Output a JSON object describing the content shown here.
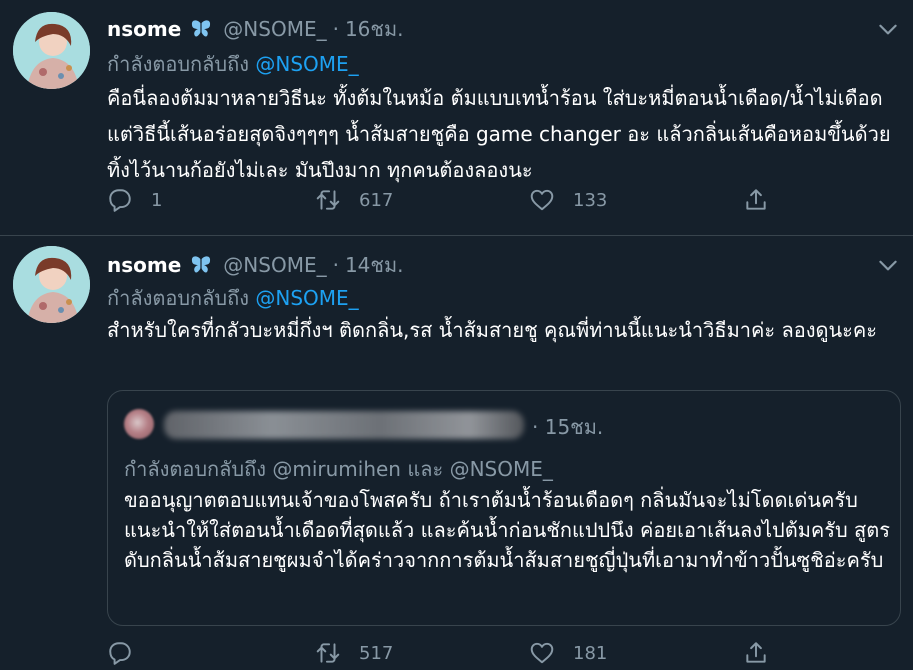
{
  "tweets": [
    {
      "display_name": "nsome",
      "verified_icon": "butterfly-icon",
      "handle": "@NSOME_",
      "dot": "·",
      "time": "16ชม.",
      "replying_prefix": "กำลังตอบกลับถึง",
      "replying_to": "@NSOME_",
      "text": "คือนี่ลองต้มมาหลายวิธีนะ ทั้งต้มในหม้อ ต้มแบบเทน้ำร้อน ใส่บะหมี่ตอนน้ำเดือด/น้ำไม่เดือด แต่วิธีนี้เส้นอร่อยสุดจิงๆๆๆๆ น้ำส้มสายชูคือ game changer อะ แล้วกลิ่นเส้นคือหอมขึ้นด้วย ทิ้งไว้นานก้อยังไม่เละ มันปึงมาก ทุกคนต้องลองนะ",
      "replies": "1",
      "retweets": "617",
      "likes": "133"
    },
    {
      "display_name": "nsome",
      "verified_icon": "butterfly-icon",
      "handle": "@NSOME_",
      "dot": "·",
      "time": "14ชม.",
      "replying_prefix": "กำลังตอบกลับถึง",
      "replying_to": "@NSOME_",
      "text": "สำหรับใครที่กลัวบะหมี่กึ่งฯ ติดกลิ่น,รส น้ำส้มสายชู คุณพี่ท่านนี้แนะนำวิธีมาค่ะ ลองดูนะคะ",
      "replies": "",
      "retweets": "517",
      "likes": "181",
      "quote": {
        "dot": "·",
        "time": "15ชม.",
        "replying": "กำลังตอบกลับถึง @mirumihen และ @NSOME_",
        "text": "ขออนุญาตตอบแทนเจ้าของโพสครับ ถ้าเราต้มน้ำร้อนเดือดๆ กลิ่นมันจะไม่โดดเด่นครับ แนะนำให้ใส่ตอนน้ำเดือดที่สุดแล้ว และค้นน้ำก่อนชักแปปนึง ค่อยเอาเส้นลงไปต้มครับ สูตรดับกลิ่นน้ำส้มสายชูผมจำได้คร่าวจากการต้มน้ำส้มสายชูญี่ปุ่นที่เอามาทำข้าวปั้นซูชิอ่ะครับ"
      }
    }
  ],
  "colors": {
    "background": "#15202b",
    "secondary_text": "#8899a6",
    "link": "#1da1f2",
    "border": "#38444d",
    "verified": "#7fc4f0"
  },
  "icons": {
    "reply": "reply-icon",
    "retweet": "retweet-icon",
    "like": "heart-icon",
    "share": "share-icon",
    "more": "chevron-down-icon"
  }
}
